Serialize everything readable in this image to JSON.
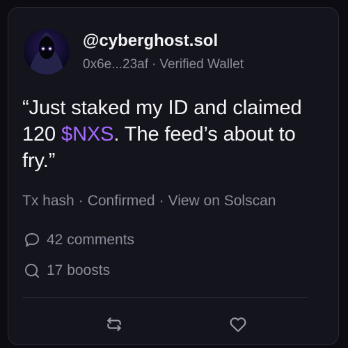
{
  "post": {
    "author": {
      "handle": "@cyberghost.sol",
      "wallet": "0x6e...23af",
      "verification": "Verified Wallet",
      "separator": "·",
      "avatar_icon": "hooded-figure-avatar"
    },
    "body": {
      "text_before": "“Just staked my ID and claimed 120 ",
      "ticker": "$NXS",
      "text_after": ". The feed’s about to fry.”"
    },
    "tx": {
      "hash_label": "Tx hash",
      "status": "Confirmed",
      "explorer_link": "View on Solscan",
      "separator": "·"
    },
    "stats": {
      "comments": "42 comments",
      "boosts": "17 boosts",
      "comments_icon": "comment-bubble-icon",
      "boosts_icon": "search-loop-icon"
    },
    "actions": {
      "repost_icon": "repost-icon",
      "like_icon": "heart-icon"
    }
  },
  "colors": {
    "background": "#0c0c12",
    "card": "#14141c",
    "accent": "#a66bff",
    "text_primary": "#f4f4f6",
    "text_secondary": "#8c8c9a"
  }
}
